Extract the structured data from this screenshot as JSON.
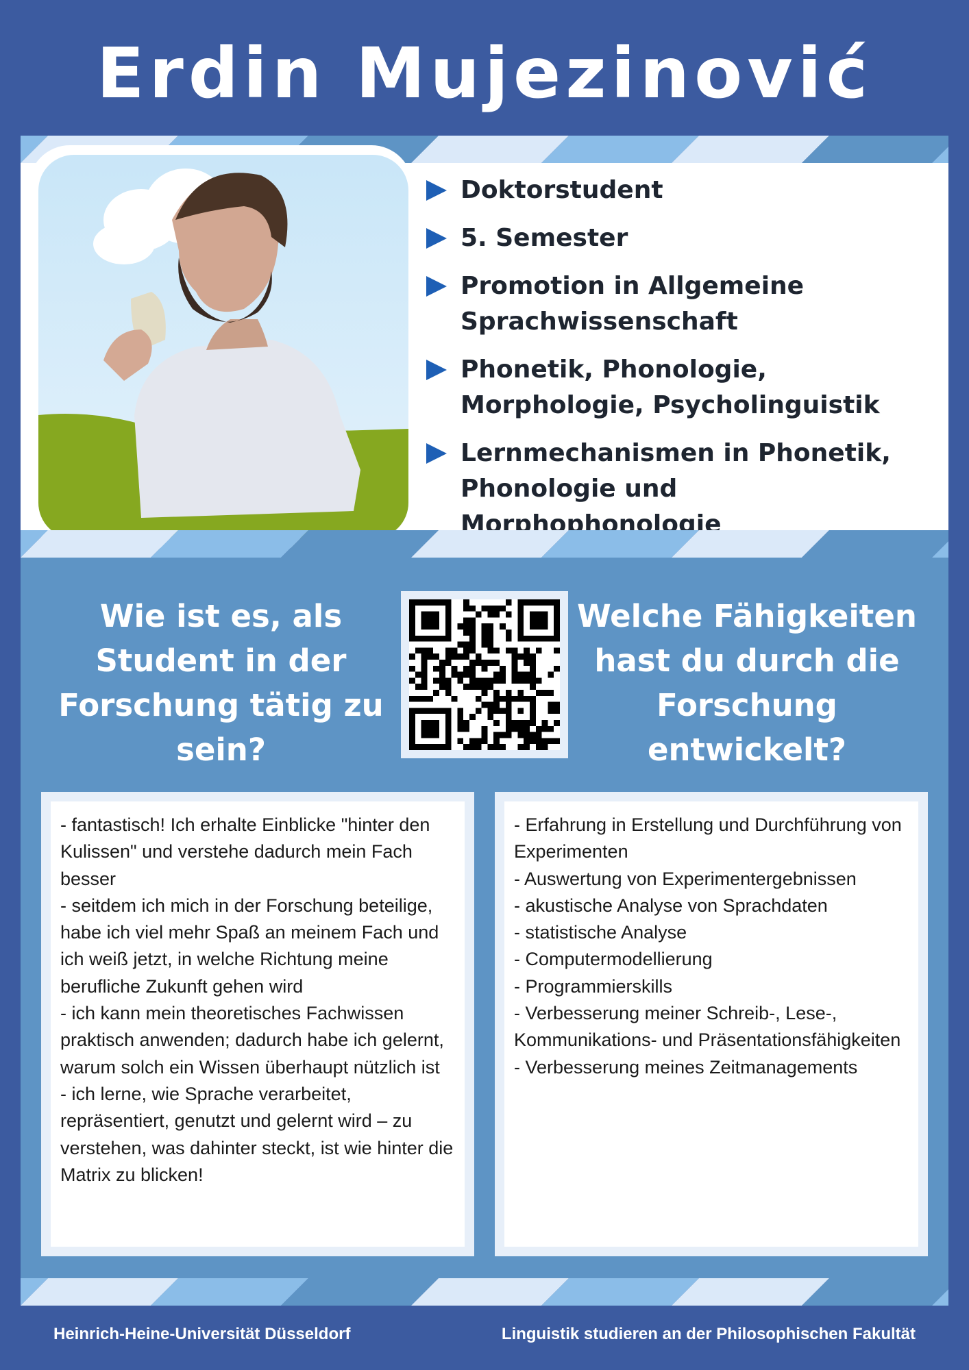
{
  "header": {
    "name": "Erdin Mujezinović"
  },
  "profile": {
    "photo_icon": "portrait-photo",
    "bullet_icon": "triangle-right",
    "bullets": [
      {
        "text": "Doktorstudent"
      },
      {
        "text": "5. Semester"
      },
      {
        "text": "Promotion in Allgemeine Sprachwissenschaft"
      },
      {
        "text": "Phonetik, Phonologie, Morphologie, Psycholinguistik"
      },
      {
        "text": "Lernmechanismen in Phonetik, Phonologie und Morphophonologie"
      }
    ]
  },
  "questions": {
    "left": "Wie ist es, als Student in der Forschung tätig zu sein?",
    "right": "Welche Fähigkeiten hast du durch die Forschung entwickelt?"
  },
  "answers": {
    "left": "- fantastisch! Ich erhalte Einblicke \"hinter den Kulissen\" und verstehe dadurch mein Fach besser\n- seitdem ich mich in der Forschung beteilige, habe ich viel mehr Spaß an meinem Fach und ich weiß jetzt, in welche Richtung meine berufliche Zukunft gehen wird\n- ich kann mein theoretisches Fachwissen praktisch anwenden; dadurch habe ich gelernt, warum solch ein Wissen überhaupt nützlich ist\n- ich lerne, wie Sprache verarbeitet, repräsentiert, genutzt und gelernt wird – zu verstehen, was dahinter steckt, ist wie hinter die Matrix zu blicken!",
    "right": "- Erfahrung in Erstellung und Durchführung von Experimenten\n- Auswertung von Experimentergebnissen\n- akustische Analyse von Sprachdaten\n- statistische Analyse\n- Computermodellierung\n- Programmierskills\n- Verbesserung meiner Schreib-, Lese-, Kommunikations- und Präsentationsfähigkeiten\n- Verbesserung meines Zeitmanagements"
  },
  "qr": {
    "icon": "qr-code"
  },
  "footer": {
    "left": "Heinrich-Heine-Universität Düsseldorf",
    "right": "Linguistik studieren an der Philosophischen Fakultät"
  },
  "colors": {
    "background": "#3c5ba0",
    "panel_blue": "#5e94c5",
    "bullet_accent": "#1e5fb5",
    "stripe_light": "#dbe9f9",
    "stripe_mid": "#8bbde8",
    "stripe_dark": "#5e94c5"
  }
}
